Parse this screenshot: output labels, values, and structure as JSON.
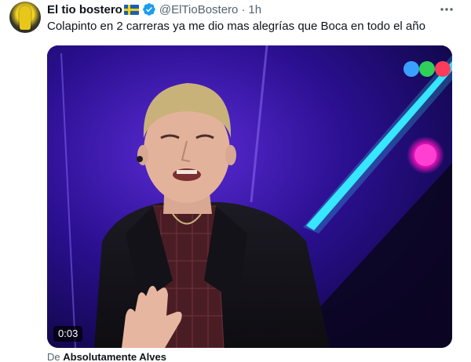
{
  "tweet": {
    "display_name": "El tio bostero",
    "flag_icon": "sweden-flag-icon",
    "verified_icon": "verified-badge-icon",
    "handle": "@ElTioBostero",
    "separator": "·",
    "time": "1h",
    "more_icon": "more-icon",
    "text": "Colapinto en 2 carreras ya me dio mas alegrías que Boca en todo el año"
  },
  "media": {
    "duration": "0:03",
    "attribution_prefix": "De",
    "attribution_source": "Absolutamente Alves"
  },
  "colors": {
    "verified_blue": "#1d9bf0",
    "text_primary": "#0f1419",
    "text_secondary": "#536471"
  }
}
